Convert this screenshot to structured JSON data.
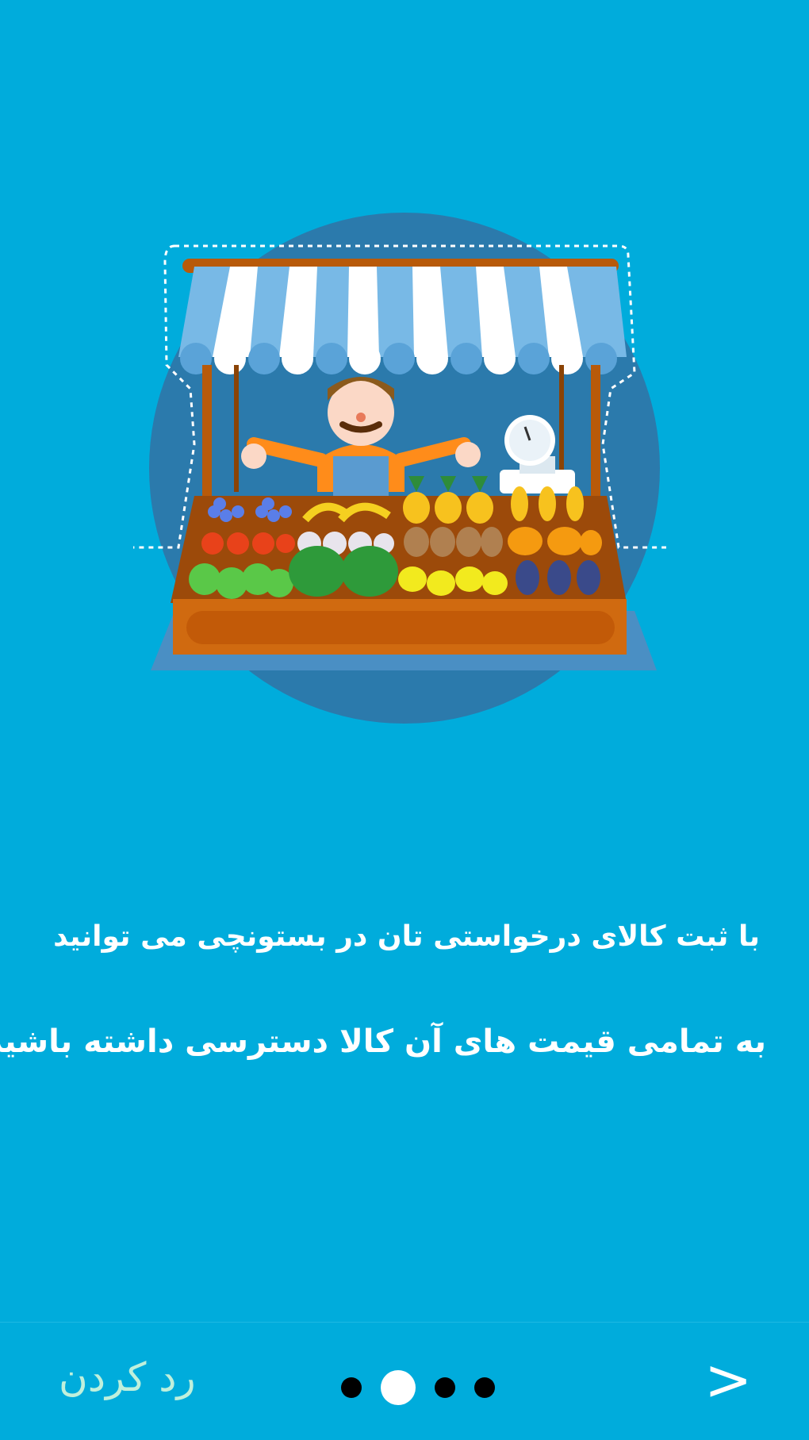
{
  "onboarding": {
    "line1": "با ثبت کالای درخواستی تان در بستونچی می توانید",
    "line2": "به تمامی قیمت های آن کالا دسترسی داشته باشید ."
  },
  "illustration": {
    "icon": "market-stall-illustration"
  },
  "bottom_bar": {
    "skip_label": "رد کردن",
    "next_label": ">",
    "page_indicator": {
      "total": 4,
      "active": 2
    }
  },
  "colors": {
    "background": "#00acdc",
    "circle": "#2b7aac",
    "skip_text": "#bff0dc"
  }
}
